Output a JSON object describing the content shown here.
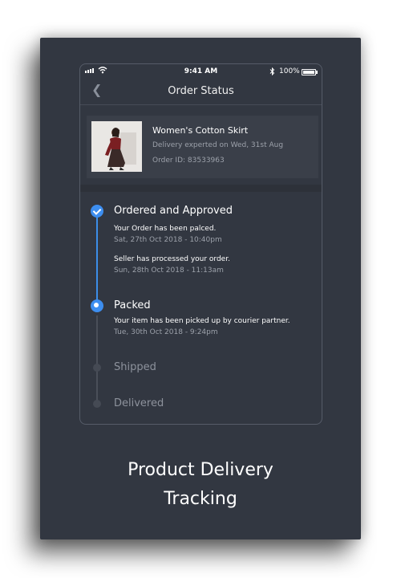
{
  "status_bar": {
    "time": "9:41 AM",
    "battery": "100%",
    "icons": [
      "signal-icon",
      "wifi-icon",
      "bluetooth-icon",
      "battery-icon"
    ]
  },
  "nav": {
    "title": "Order Status",
    "back_icon": "chevron-left-icon"
  },
  "product": {
    "name": "Women's Cotton Skirt",
    "delivery": "Delivery experted on Wed, 31st Aug",
    "order_id": "Order ID: 83533963"
  },
  "timeline": {
    "steps": [
      {
        "title": "Ordered and Approved",
        "state": "completed",
        "events": [
          {
            "text": "Your Order has been palced.",
            "time": "Sat, 27th Oct 2018 - 10:40pm"
          },
          {
            "text": "Seller has processed your order.",
            "time": "Sun, 28th Oct 2018 - 11:13am"
          }
        ]
      },
      {
        "title": "Packed",
        "state": "current",
        "events": [
          {
            "text": "Your item has been picked up by courier partner.",
            "time": "Tue, 30th Oct 2018 - 9:24pm"
          }
        ]
      },
      {
        "title": "Shipped",
        "state": "pending"
      },
      {
        "title": "Delivered",
        "state": "pending"
      }
    ]
  },
  "caption": {
    "line1": "Product Delivery",
    "line2": "Tracking"
  },
  "colors": {
    "background": "#323741",
    "accent": "#3d8ef0",
    "text_primary": "#ffffff",
    "text_secondary": "#9ca1aa",
    "inactive": "#454a54"
  }
}
